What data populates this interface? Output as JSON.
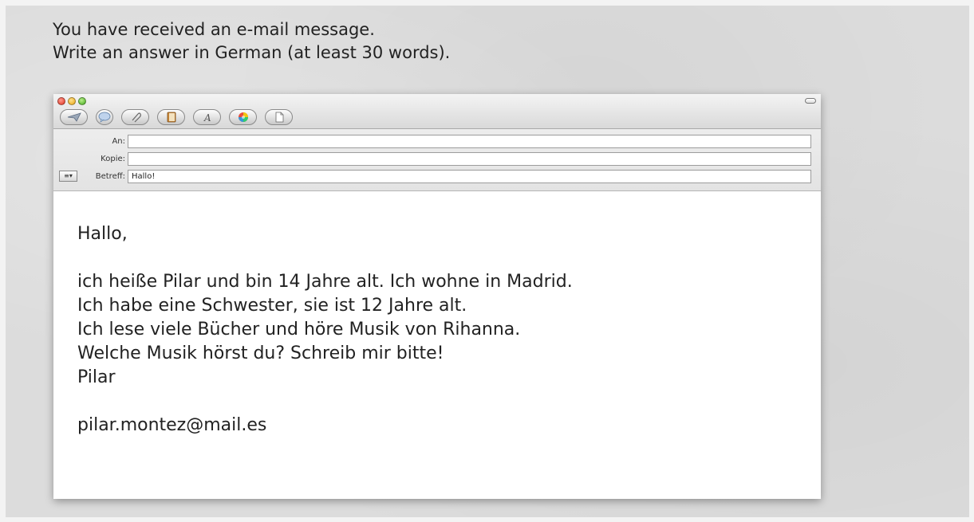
{
  "instructions": {
    "line1": "You have received an e-mail message.",
    "line2": "Write an answer in German (at least 30 words)."
  },
  "mail_window": {
    "toolbar": [
      {
        "icon": "send-icon"
      },
      {
        "icon": "chat-icon"
      },
      {
        "icon": "attach-icon"
      },
      {
        "icon": "address-book-icon"
      },
      {
        "icon": "fonts-icon"
      },
      {
        "icon": "colors-icon"
      },
      {
        "icon": "stationery-icon"
      }
    ],
    "fields": {
      "to_label": "An:",
      "to_value": "",
      "cc_label": "Kopie:",
      "cc_value": "",
      "subject_label": "Betreff:",
      "subject_value": "Hallo!",
      "menu_symbol": "≡▾"
    },
    "message": {
      "greeting": "Hallo,",
      "line1": "ich heiße Pilar und bin 14 Jahre alt. Ich wohne in Madrid.",
      "line2": "Ich habe eine Schwester, sie ist 12 Jahre alt.",
      "line3": "Ich lese viele Bücher und höre Musik von Rihanna.",
      "line4": "Welche Musik hörst du? Schreib mir bitte!",
      "signature": "Pilar",
      "email": "pilar.montez@mail.es"
    }
  },
  "colors": {
    "background": "#dcdcdc",
    "window_bg": "#ffffff",
    "text": "#222222"
  }
}
